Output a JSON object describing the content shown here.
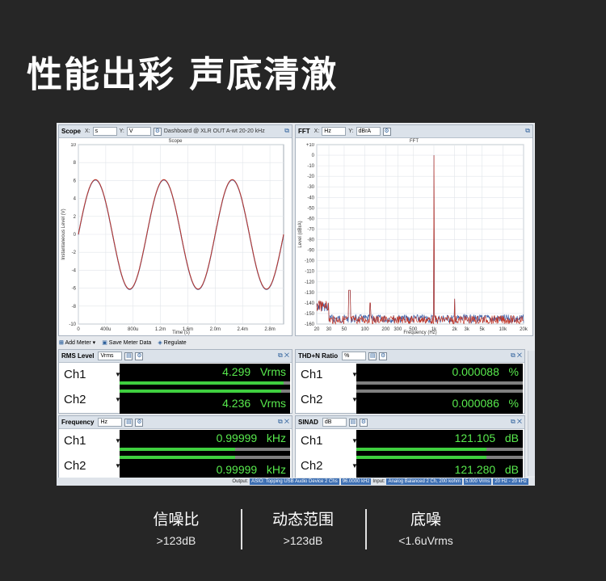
{
  "banner": {
    "title": "性能出彩  声底清澈"
  },
  "scope": {
    "title": "Scope",
    "x_axis_label": "X:",
    "x_unit": "s",
    "y_axis_label": "Y:",
    "y_unit": "V",
    "source": "Dashboard @ XLR OUT  A-wt 20-20 kHz",
    "plot_title": "Scope",
    "ylabel": "Instantaneous Level (V)",
    "xlabel": "Time (s)",
    "yticks": [
      "10",
      "8",
      "6",
      "4",
      "2",
      "0",
      "-2",
      "-4",
      "-6",
      "-8",
      "-10"
    ],
    "xticks": [
      "0",
      "400u",
      "800u",
      "1.2m",
      "1.6m",
      "2.0m",
      "2.4m",
      "2.8m"
    ]
  },
  "fft": {
    "title": "FFT",
    "x_axis_label": "X:",
    "x_unit": "Hz",
    "y_axis_label": "Y:",
    "y_unit": "dBrA",
    "plot_title": "FFT",
    "ylabel": "Level (dBrA)",
    "xlabel": "Frequency (Hz)",
    "yticks": [
      "+10",
      "0",
      "-10",
      "-20",
      "-30",
      "-40",
      "-50",
      "-60",
      "-70",
      "-80",
      "-90",
      "-100",
      "-110",
      "-120",
      "-130",
      "-140",
      "-150",
      "-160"
    ],
    "xticks": [
      "20",
      "30",
      "50",
      "100",
      "200",
      "300",
      "500",
      "1k",
      "2k",
      "3k",
      "5k",
      "10k",
      "20k"
    ]
  },
  "toolbar": {
    "add_meter": "Add Meter",
    "save_meter_data": "Save Meter Data",
    "regulate": "Regulate"
  },
  "meters": {
    "rms": {
      "title": "RMS Level",
      "unit_select": "Vrms",
      "ch1_label": "Ch1",
      "ch1_value": "4.299",
      "ch1_unit": "Vrms",
      "ch2_label": "Ch2",
      "ch2_value": "4.236",
      "ch2_unit": "Vrms"
    },
    "thdn": {
      "title": "THD+N Ratio",
      "unit_select": "%",
      "ch1_label": "Ch1",
      "ch1_value": "0.000088",
      "ch1_unit": "%",
      "ch2_label": "Ch2",
      "ch2_value": "0.000086",
      "ch2_unit": "%"
    },
    "freq": {
      "title": "Frequency",
      "unit_select": "Hz",
      "ch1_label": "Ch1",
      "ch1_value": "0.99999",
      "ch1_unit": "kHz",
      "ch2_label": "Ch2",
      "ch2_value": "0.99999",
      "ch2_unit": "kHz"
    },
    "sinad": {
      "title": "SINAD",
      "unit_select": "dB",
      "ch1_label": "Ch1",
      "ch1_value": "121.105",
      "ch1_unit": "dB",
      "ch2_label": "Ch2",
      "ch2_value": "121.280",
      "ch2_unit": "dB"
    }
  },
  "status": {
    "output_label": "Output:",
    "output_device": "ASIO: Topping USB Audio Device 2 Chs",
    "output_rate": "96.0000 kHz",
    "input_label": "Input:",
    "input_device": "Analog Balanced 2 Ch, 200 kohm",
    "input_level": "5.000 Vrms",
    "input_band": "20 Hz - 20 kHz"
  },
  "specs": [
    {
      "label": "信噪比",
      "value": ">123dB"
    },
    {
      "label": "动态范围",
      "value": ">123dB"
    },
    {
      "label": "底噪",
      "value": "<1.6uVrms"
    }
  ],
  "colors": {
    "background": "#262626",
    "meter_text": "#58ea4d",
    "meter_bar": "#3fcf3f",
    "trace_red": "#c0392b",
    "trace_blue": "#3b5fa8"
  }
}
